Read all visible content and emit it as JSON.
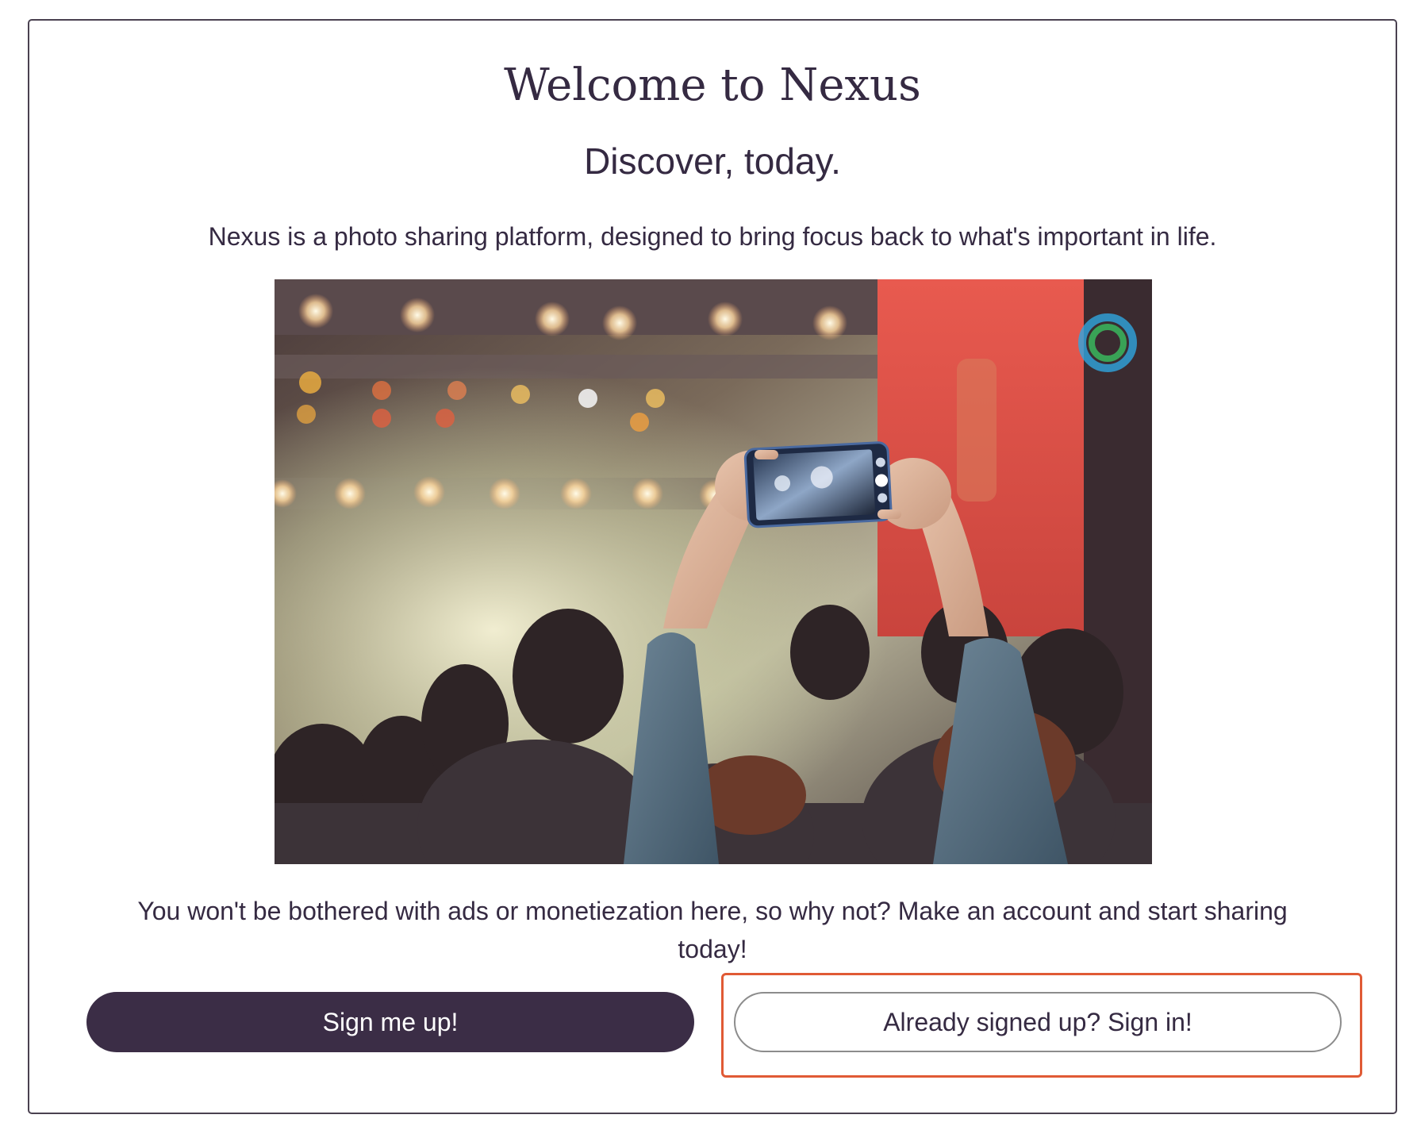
{
  "page": {
    "title": "Welcome to Nexus",
    "subtitle": "Discover, today.",
    "description": "Nexus is a photo sharing platform, designed to bring focus back to what's important in life.",
    "pitch": "You won't be bothered with ads or monetiezation here, so why not? Make an account and start sharing today!"
  },
  "actions": {
    "signup_label": "Sign me up!",
    "signin_label": "Already signed up? Sign in!"
  },
  "colors": {
    "primary": "#3b2d46",
    "text": "#352a42",
    "highlight": "#e05a35"
  }
}
